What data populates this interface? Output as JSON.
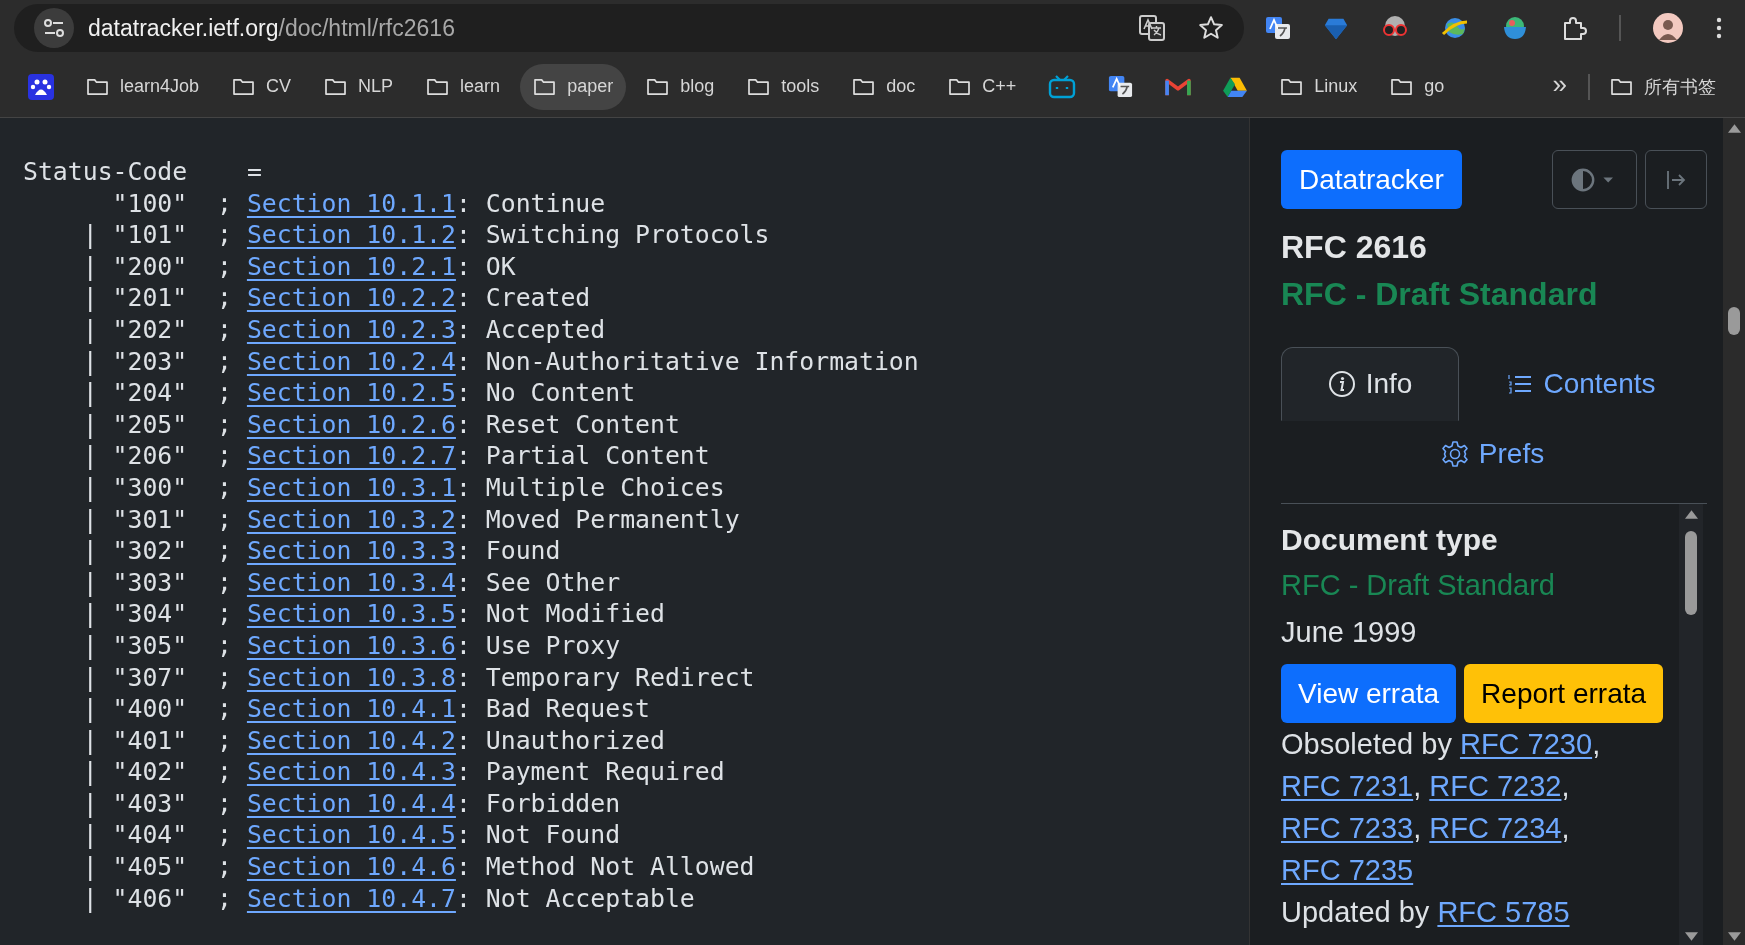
{
  "address_bar": {
    "host": "datatracker.ietf.org",
    "path": "/doc/html/rfc2616"
  },
  "bookmarks": [
    {
      "kind": "paw",
      "highlighted": false
    },
    {
      "kind": "folder",
      "label": "learn4Job",
      "highlighted": false
    },
    {
      "kind": "folder",
      "label": "CV",
      "highlighted": false
    },
    {
      "kind": "folder",
      "label": "NLP",
      "highlighted": false
    },
    {
      "kind": "folder",
      "label": "learn",
      "highlighted": false
    },
    {
      "kind": "folder",
      "label": "paper",
      "highlighted": true
    },
    {
      "kind": "folder",
      "label": "blog",
      "highlighted": false
    },
    {
      "kind": "folder",
      "label": "tools",
      "highlighted": false
    },
    {
      "kind": "folder",
      "label": "doc",
      "highlighted": false
    },
    {
      "kind": "folder",
      "label": "C++",
      "highlighted": false
    },
    {
      "kind": "tv",
      "highlighted": false
    },
    {
      "kind": "translate",
      "highlighted": false
    },
    {
      "kind": "mail",
      "highlighted": false
    },
    {
      "kind": "triangle",
      "highlighted": false
    },
    {
      "kind": "folder",
      "label": "Linux",
      "highlighted": false
    },
    {
      "kind": "folder",
      "label": "go",
      "highlighted": false
    }
  ],
  "bookmarks_overflow": "»",
  "all_bookmarks": "所有书签",
  "document": {
    "status_line": "Status-Code    =",
    "rows": [
      {
        "lead": "\"100\"  ;",
        "link": "Section 10.1.1",
        "rest": ": Continue"
      },
      {
        "lead": "| \"101\"  ;",
        "link": "Section 10.1.2",
        "rest": ": Switching Protocols"
      },
      {
        "lead": "| \"200\"  ;",
        "link": "Section 10.2.1",
        "rest": ": OK"
      },
      {
        "lead": "| \"201\"  ;",
        "link": "Section 10.2.2",
        "rest": ": Created"
      },
      {
        "lead": "| \"202\"  ;",
        "link": "Section 10.2.3",
        "rest": ": Accepted"
      },
      {
        "lead": "| \"203\"  ;",
        "link": "Section 10.2.4",
        "rest": ": Non-Authoritative Information"
      },
      {
        "lead": "| \"204\"  ;",
        "link": "Section 10.2.5",
        "rest": ": No Content"
      },
      {
        "lead": "| \"205\"  ;",
        "link": "Section 10.2.6",
        "rest": ": Reset Content"
      },
      {
        "lead": "| \"206\"  ;",
        "link": "Section 10.2.7",
        "rest": ": Partial Content"
      },
      {
        "lead": "| \"300\"  ;",
        "link": "Section 10.3.1",
        "rest": ": Multiple Choices"
      },
      {
        "lead": "| \"301\"  ;",
        "link": "Section 10.3.2",
        "rest": ": Moved Permanently"
      },
      {
        "lead": "| \"302\"  ;",
        "link": "Section 10.3.3",
        "rest": ": Found"
      },
      {
        "lead": "| \"303\"  ;",
        "link": "Section 10.3.4",
        "rest": ": See Other"
      },
      {
        "lead": "| \"304\"  ;",
        "link": "Section 10.3.5",
        "rest": ": Not Modified"
      },
      {
        "lead": "| \"305\"  ;",
        "link": "Section 10.3.6",
        "rest": ": Use Proxy"
      },
      {
        "lead": "| \"307\"  ;",
        "link": "Section 10.3.8",
        "rest": ": Temporary Redirect"
      },
      {
        "lead": "| \"400\"  ;",
        "link": "Section 10.4.1",
        "rest": ": Bad Request"
      },
      {
        "lead": "| \"401\"  ;",
        "link": "Section 10.4.2",
        "rest": ": Unauthorized"
      },
      {
        "lead": "| \"402\"  ;",
        "link": "Section 10.4.3",
        "rest": ": Payment Required"
      },
      {
        "lead": "| \"403\"  ;",
        "link": "Section 10.4.4",
        "rest": ": Forbidden"
      },
      {
        "lead": "| \"404\"  ;",
        "link": "Section 10.4.5",
        "rest": ": Not Found"
      },
      {
        "lead": "| \"405\"  ;",
        "link": "Section 10.4.6",
        "rest": ": Method Not Allowed"
      },
      {
        "lead": "| \"406\"  ;",
        "link": "Section 10.4.7",
        "rest": ": Not Acceptable"
      }
    ]
  },
  "sidebar": {
    "brand": "Datatracker",
    "title": "RFC 2616",
    "status": "RFC - Draft Standard",
    "tabs": [
      {
        "kind": "info",
        "label": "Info",
        "selected": true
      },
      {
        "kind": "list",
        "label": "Contents",
        "selected": false
      },
      {
        "kind": "gear",
        "label": "Prefs",
        "selected": false
      }
    ],
    "info": {
      "heading": "Document type",
      "type": "RFC - Draft Standard",
      "date": "June 1999",
      "buttons": [
        {
          "kind": "primary",
          "label": "View errata"
        },
        {
          "kind": "warning",
          "label": "Report errata"
        }
      ],
      "relations": [
        {
          "label": "Obsoleted by",
          "links": [
            "RFC 7230",
            "RFC 7231",
            "RFC 7232",
            "RFC 7233",
            "RFC 7234",
            "RFC 7235"
          ],
          "separator": ","
        },
        {
          "label": "Updated by",
          "links": [
            "RFC 5785"
          ]
        }
      ]
    }
  }
}
